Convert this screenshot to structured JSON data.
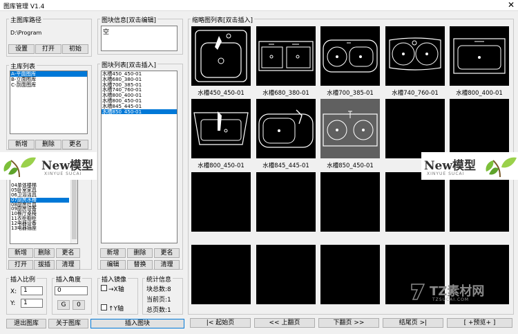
{
  "window": {
    "title": "图库管理 V1.4",
    "close_icon": "close-icon"
  },
  "main_library": {
    "path_group_label": "主图库路径",
    "path_value": "D:\\Program",
    "buttons": [
      "设置",
      "打开",
      "初始"
    ]
  },
  "library_list": {
    "label": "主库列表",
    "items": [
      "A-平面图库",
      "B-立面图库",
      "C-剖面图库"
    ],
    "selected_index": 0,
    "buttons": [
      "新增",
      "删除",
      "更名"
    ]
  },
  "category_list": {
    "items": [
      "04单体楼梯",
      "05卧室家具",
      "06卫浴洁具",
      "07厨房水槽",
      "08厨房灶具",
      "09厨房设备",
      "10餐厅桌椅",
      "11衣柜橱柜",
      "12电器设备",
      "13电器插座"
    ],
    "selected_index": 3,
    "buttons_row1": [
      "新增",
      "删除",
      "更名"
    ],
    "buttons_row2": [
      "打开",
      "拔插",
      "清理"
    ]
  },
  "block_info": {
    "label": "图块信息[双击编辑]",
    "value": "空"
  },
  "block_list": {
    "label": "图块列表[双击插入]",
    "items": [
      "水槽450_450-01",
      "水槽680_380-01",
      "水槽700_385-01",
      "水槽740_760-01",
      "水槽800_400-01",
      "水槽800_450-01",
      "水槽845_445-01",
      "水槽850_450-01"
    ],
    "selected_index": 7,
    "buttons_row1": [
      "新增",
      "删除",
      "更名"
    ],
    "buttons_row2": [
      "编辑",
      "替换",
      "清理"
    ]
  },
  "thumbnails": {
    "label": "缩略图列表[双击插入]",
    "captions": [
      "水槽450_450-01",
      "水槽680_380-01",
      "水槽700_385-01",
      "水槽740_760-01",
      "水槽800_400-01",
      "水槽800_450-01",
      "水槽845_445-01",
      "水槽850_450-01"
    ],
    "selected_index": 7
  },
  "insert_scale": {
    "label": "插入比例",
    "x_label": "X:",
    "x_value": "1",
    "y_label": "Y:",
    "y_value": "1"
  },
  "insert_angle": {
    "label": "插入角度",
    "value": "0",
    "g_button": "G",
    "zero_button": "0"
  },
  "insert_mirror": {
    "label": "插入镜像",
    "x_axis": "→X轴",
    "y_axis": "↑Y轴"
  },
  "stats": {
    "label": "统计信息",
    "total_blocks": "块总数:8",
    "current_page": "当前页:1",
    "total_pages": "总页数:1"
  },
  "bottom_buttons": {
    "exit": "退出图库",
    "about": "关于图库",
    "insert": "插入图块"
  },
  "pager": {
    "first": "|< 起始页",
    "prev": "<< 上翻页",
    "next": "下翻页 >>",
    "last": "结尾页 >|",
    "preview": "[ +预览+ ]"
  },
  "watermarks": {
    "left": {
      "brand": "New模型",
      "sub": "XINYUE SUCAI"
    },
    "right": {
      "brand": "New模型",
      "sub": "XINYUE SUCAI"
    },
    "tz": {
      "brand": "TZ素材网",
      "sub": "TZSUCAI.COM"
    }
  },
  "colors": {
    "selection": "#0078d7",
    "thumb_bg": "#000000",
    "thumb_selected": "#606060"
  }
}
